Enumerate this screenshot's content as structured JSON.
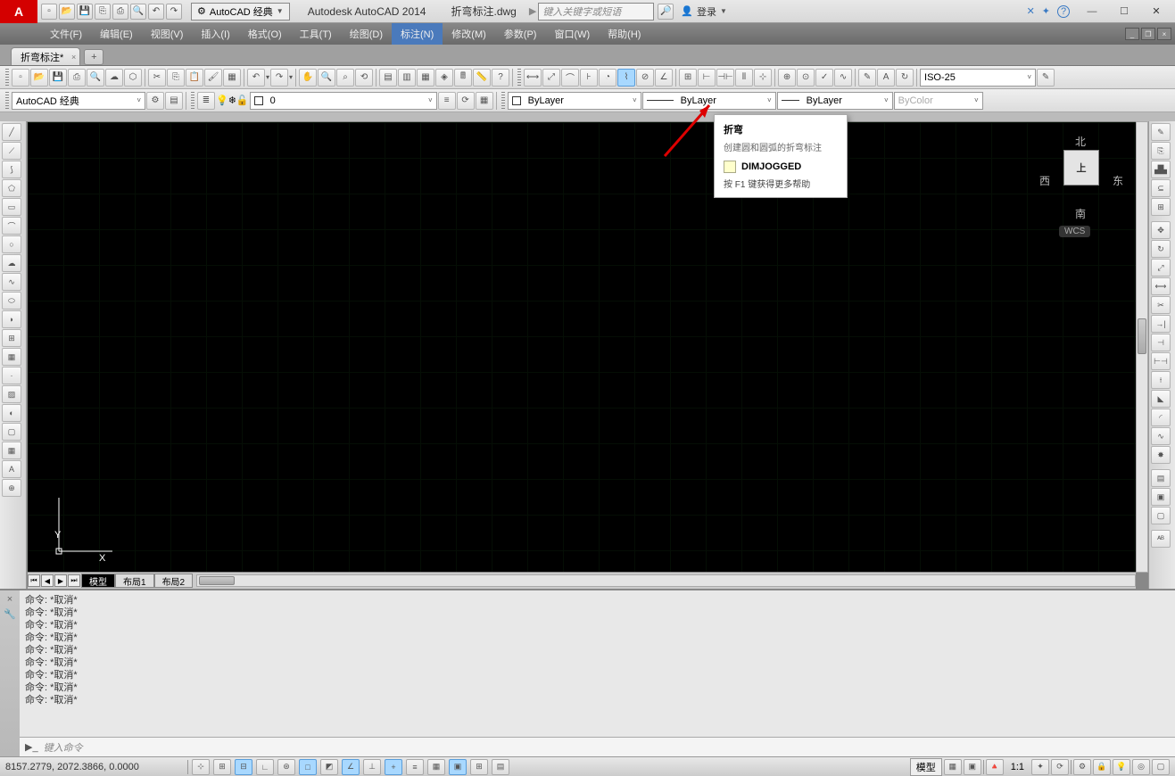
{
  "title": {
    "app": "Autodesk AutoCAD 2014",
    "file": "折弯标注.dwg"
  },
  "search_placeholder": "键入关键字或短语",
  "login_label": "登录",
  "workspace_dd": "AutoCAD 经典",
  "menus": [
    "文件(F)",
    "编辑(E)",
    "视图(V)",
    "插入(I)",
    "格式(O)",
    "工具(T)",
    "绘图(D)",
    "标注(N)",
    "修改(M)",
    "参数(P)",
    "窗口(W)",
    "帮助(H)"
  ],
  "active_menu_index": 7,
  "file_tab": "折弯标注*",
  "props": {
    "workspace": "AutoCAD 经典",
    "layer": "0",
    "color": "ByLayer",
    "line1": "ByLayer",
    "line2": "ByLayer",
    "plot": "ByColor",
    "dimstyle": "ISO-25"
  },
  "tooltip": {
    "title": "折弯",
    "desc": "创建圆和圆弧的折弯标注",
    "cmd": "DIMJOGGED",
    "help": "按 F1 键获得更多帮助"
  },
  "viewcube": {
    "top": "上",
    "n": "北",
    "s": "南",
    "e": "东",
    "w": "西",
    "wcs": "WCS"
  },
  "model_tabs": [
    "模型",
    "布局1",
    "布局2"
  ],
  "cmd_history": [
    "命令:  *取消*",
    "命令:  *取消*",
    "命令:  *取消*",
    "命令:  *取消*",
    "命令:  *取消*",
    "命令:  *取消*",
    "命令:  *取消*",
    "命令:  *取消*",
    "命令:  *取消*"
  ],
  "cmd_prompt": "▶_",
  "cmd_placeholder": "键入命令",
  "status": {
    "coords": "8157.2779, 2072.3866, 0.0000",
    "model_btn": "模型",
    "scale": "1:1"
  },
  "ucs": {
    "x": "X",
    "y": "Y"
  }
}
